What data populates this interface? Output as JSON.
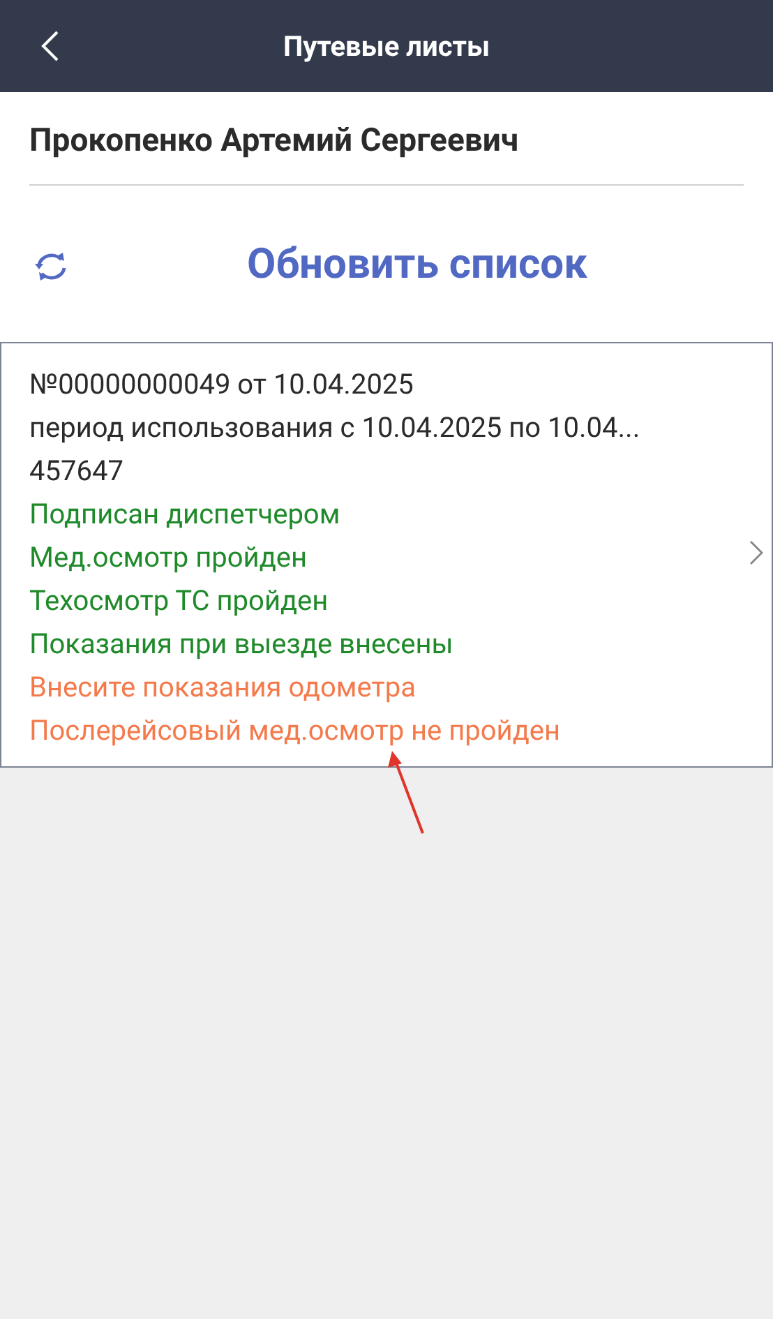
{
  "header": {
    "title": "Путевые листы"
  },
  "driver": {
    "name": "Прокопенко Артемий Сергеевич"
  },
  "refresh": {
    "label": "Обновить список"
  },
  "waybills": [
    {
      "number": "№00000000049 от 10.04.2025",
      "period": "период использования с 10.04.2025 по 10.04...",
      "vehicle": "457647",
      "statuses": [
        {
          "text": "Подписан диспетчером",
          "kind": "done"
        },
        {
          "text": "Мед.осмотр пройден",
          "kind": "done"
        },
        {
          "text": "Техосмотр ТС пройден",
          "kind": "done"
        },
        {
          "text": "Показания при выезде внесены",
          "kind": "done"
        },
        {
          "text": "Внесите показания одометра",
          "kind": "pending"
        },
        {
          "text": "Послерейсовый мед.осмотр не пройден",
          "kind": "pending"
        }
      ]
    }
  ]
}
